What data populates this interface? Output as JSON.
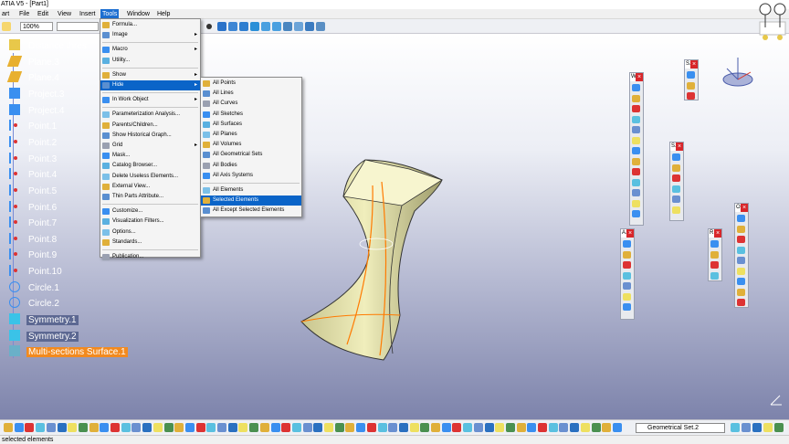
{
  "window": {
    "title": "ATIA V5 - [Part1]"
  },
  "menubar": {
    "items": [
      "art",
      "File",
      "Edit",
      "View",
      "Insert",
      "Tools",
      "Window",
      "Help"
    ]
  },
  "toolbar_top": {
    "zoom": "100%"
  },
  "tree": {
    "items": [
      {
        "label": "Distance thres",
        "kind": "law"
      },
      {
        "label": "Plane.3",
        "kind": "plane"
      },
      {
        "label": "Plane.4",
        "kind": "plane"
      },
      {
        "label": "Project.3",
        "kind": "curve"
      },
      {
        "label": "Project.4",
        "kind": "curve"
      },
      {
        "label": "Point.1",
        "kind": "point"
      },
      {
        "label": "Point.2",
        "kind": "point"
      },
      {
        "label": "Point.3",
        "kind": "point"
      },
      {
        "label": "Point.4",
        "kind": "point"
      },
      {
        "label": "Point.5",
        "kind": "point"
      },
      {
        "label": "Point.6",
        "kind": "point"
      },
      {
        "label": "Point.7",
        "kind": "point"
      },
      {
        "label": "Point.8",
        "kind": "point"
      },
      {
        "label": "Point.9",
        "kind": "point"
      },
      {
        "label": "Point.10",
        "kind": "point"
      },
      {
        "label": "Circle.1",
        "kind": "circle"
      },
      {
        "label": "Circle.2",
        "kind": "circle"
      },
      {
        "label": "Symmetry.1",
        "kind": "symmetry"
      },
      {
        "label": "Symmetry.2",
        "kind": "symmetry"
      },
      {
        "label": "Multi-sections Surface.1",
        "kind": "surface",
        "highlighted": true
      }
    ]
  },
  "tools_menu": {
    "items": [
      {
        "label": "Formula..."
      },
      {
        "label": "Image",
        "submenu": true
      },
      {
        "sep": true
      },
      {
        "label": "Macro",
        "submenu": true
      },
      {
        "label": "Utility..."
      },
      {
        "sep": true
      },
      {
        "label": "Show",
        "submenu": true
      },
      {
        "label": "Hide",
        "submenu": true,
        "selected": true
      },
      {
        "sep": true
      },
      {
        "label": "In Work Object",
        "submenu": true
      },
      {
        "sep": true
      },
      {
        "label": "Parameterization Analysis..."
      },
      {
        "label": "Parents/Children..."
      },
      {
        "label": "Show Historical Graph..."
      },
      {
        "label": "Grid",
        "submenu": true
      },
      {
        "label": "Mask..."
      },
      {
        "label": "Catalog Browser..."
      },
      {
        "label": "Delete Useless Elements..."
      },
      {
        "label": "External View..."
      },
      {
        "label": "Thin Parts Attribute..."
      },
      {
        "sep": true
      },
      {
        "label": "Customize..."
      },
      {
        "label": "Visualization Filters..."
      },
      {
        "label": "Options..."
      },
      {
        "label": "Standards..."
      },
      {
        "sep": true
      },
      {
        "label": "Publication..."
      }
    ]
  },
  "hide_submenu": {
    "items": [
      {
        "label": "All Points"
      },
      {
        "label": "All Lines"
      },
      {
        "label": "All Curves"
      },
      {
        "label": "All Sketches"
      },
      {
        "label": "All Surfaces"
      },
      {
        "label": "All Planes"
      },
      {
        "label": "All Volumes"
      },
      {
        "label": "All Geometrical Sets"
      },
      {
        "label": "All Bodies"
      },
      {
        "label": "All Axis Systems"
      },
      {
        "sep": true
      },
      {
        "label": "All Elements"
      },
      {
        "label": "Selected Elements",
        "selected": true
      },
      {
        "label": "All Except Selected Elements"
      }
    ]
  },
  "floating_toolbars": [
    {
      "title": "W"
    },
    {
      "title": "S."
    },
    {
      "title": "S."
    },
    {
      "title": "A."
    },
    {
      "title": "R."
    },
    {
      "title": "O."
    }
  ],
  "bottom_toolbar": {
    "geometrical_set": "Geometrical Set.2"
  },
  "status": {
    "text": "selected elements"
  },
  "colors": {
    "menu_highlight": "#0a64c8",
    "tree_highlight": "#f28a1f",
    "viewport_top": "#ffffff",
    "viewport_bottom": "#7d83ab",
    "surface": "#d9d7a6"
  }
}
